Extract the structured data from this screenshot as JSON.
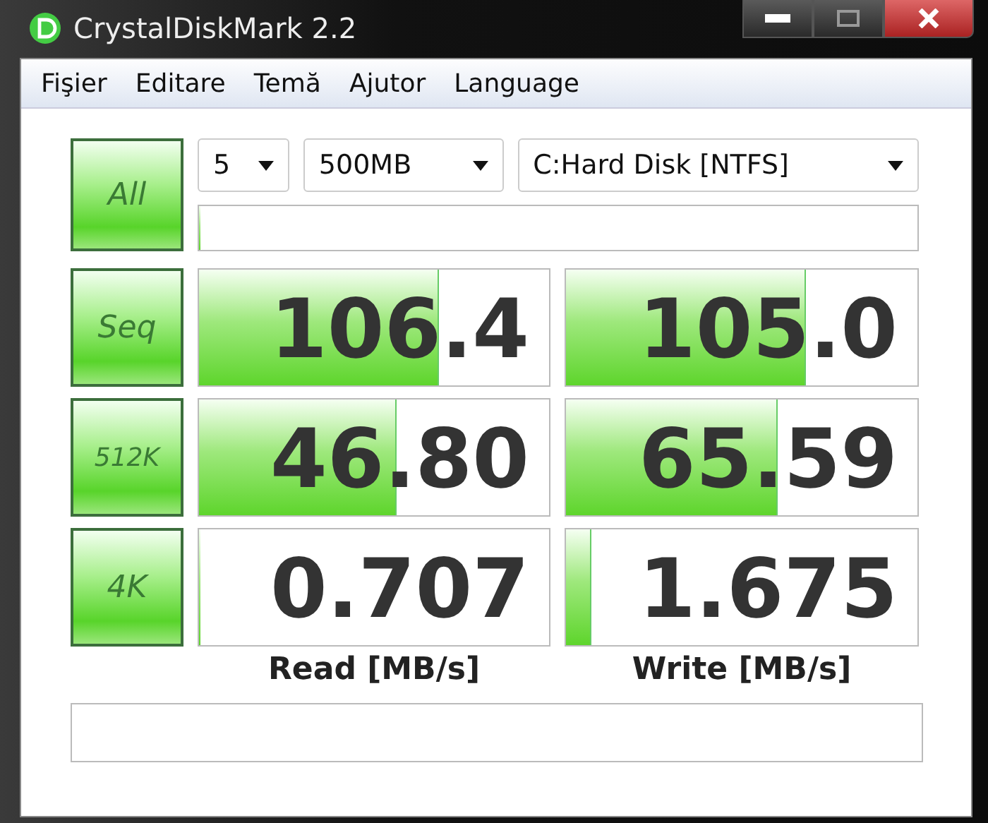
{
  "window": {
    "title": "CrystalDiskMark 2.2"
  },
  "menu": [
    "Fişier",
    "Editare",
    "Temă",
    "Ajutor",
    "Language"
  ],
  "controls": {
    "all_button": "All",
    "count": "5",
    "size": "500MB",
    "drive": "C:Hard Disk [NTFS]"
  },
  "progress": {
    "level": 0
  },
  "rows": [
    {
      "test": "Seq",
      "read": {
        "value": "106.4",
        "level": 0.68
      },
      "write": {
        "value": "105.0",
        "level": 0.68
      }
    },
    {
      "test": "512K",
      "read": {
        "value": "46.80",
        "level": 0.56
      },
      "write": {
        "value": "65.59",
        "level": 0.6
      }
    },
    {
      "test": "4K",
      "read": {
        "value": "0.707",
        "level": 0
      },
      "write": {
        "value": "1.675",
        "level": 0.07
      }
    }
  ],
  "column_labels": [
    "Read [MB/s]",
    "Write [MB/s]"
  ]
}
